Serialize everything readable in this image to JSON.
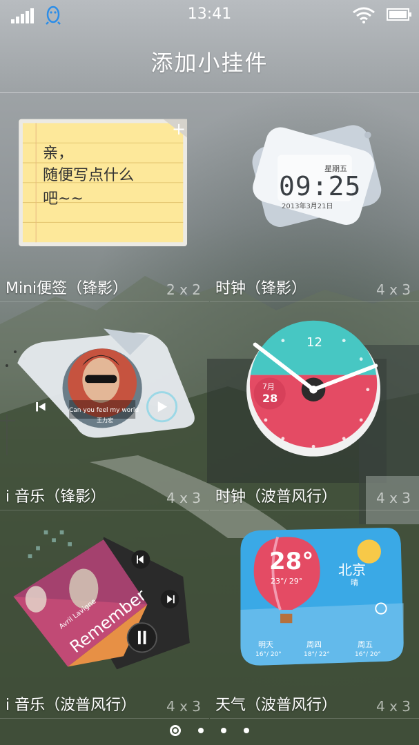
{
  "status_bar": {
    "time": "13:41"
  },
  "page_title": "添加小挂件",
  "widgets": [
    {
      "label": "Mini便签（锋影）",
      "size": "2 x 2",
      "note_lines": [
        "亲，",
        "随便写点什么",
        "吧~~"
      ]
    },
    {
      "label": "时钟（锋影）",
      "size": "4 x 3",
      "weekday": "星期五",
      "time": "09:25",
      "date": "2013年3月21日"
    },
    {
      "label": "i 音乐（锋影）",
      "size": "4 x 3",
      "song": "Can you feel my world",
      "artist": "王力宏"
    },
    {
      "label": "时钟（波普风行）",
      "size": "4 x 3",
      "twelve": "12",
      "month": "7月",
      "day": "28"
    },
    {
      "label": "i 音乐（波普风行）",
      "size": "4 x 3",
      "artist": "Avril Lavigne",
      "album": "Remember"
    },
    {
      "label": "天气（波普风行）",
      "size": "4 x 3",
      "temp": "28°",
      "range": "23°/ 29°",
      "city": "北京",
      "condition": "晴",
      "forecast": [
        {
          "day": "明天",
          "range": "16°/ 20°"
        },
        {
          "day": "周四",
          "range": "18°/ 22°"
        },
        {
          "day": "周五",
          "range": "16°/ 20°"
        }
      ]
    }
  ],
  "pager": {
    "pages": 4,
    "current": 1
  },
  "colors": {
    "note_yellow": "#fde89a",
    "clock_teal": "#47c7c3",
    "clock_red": "#e44b64",
    "weather_sky": "#3aa9e6"
  }
}
